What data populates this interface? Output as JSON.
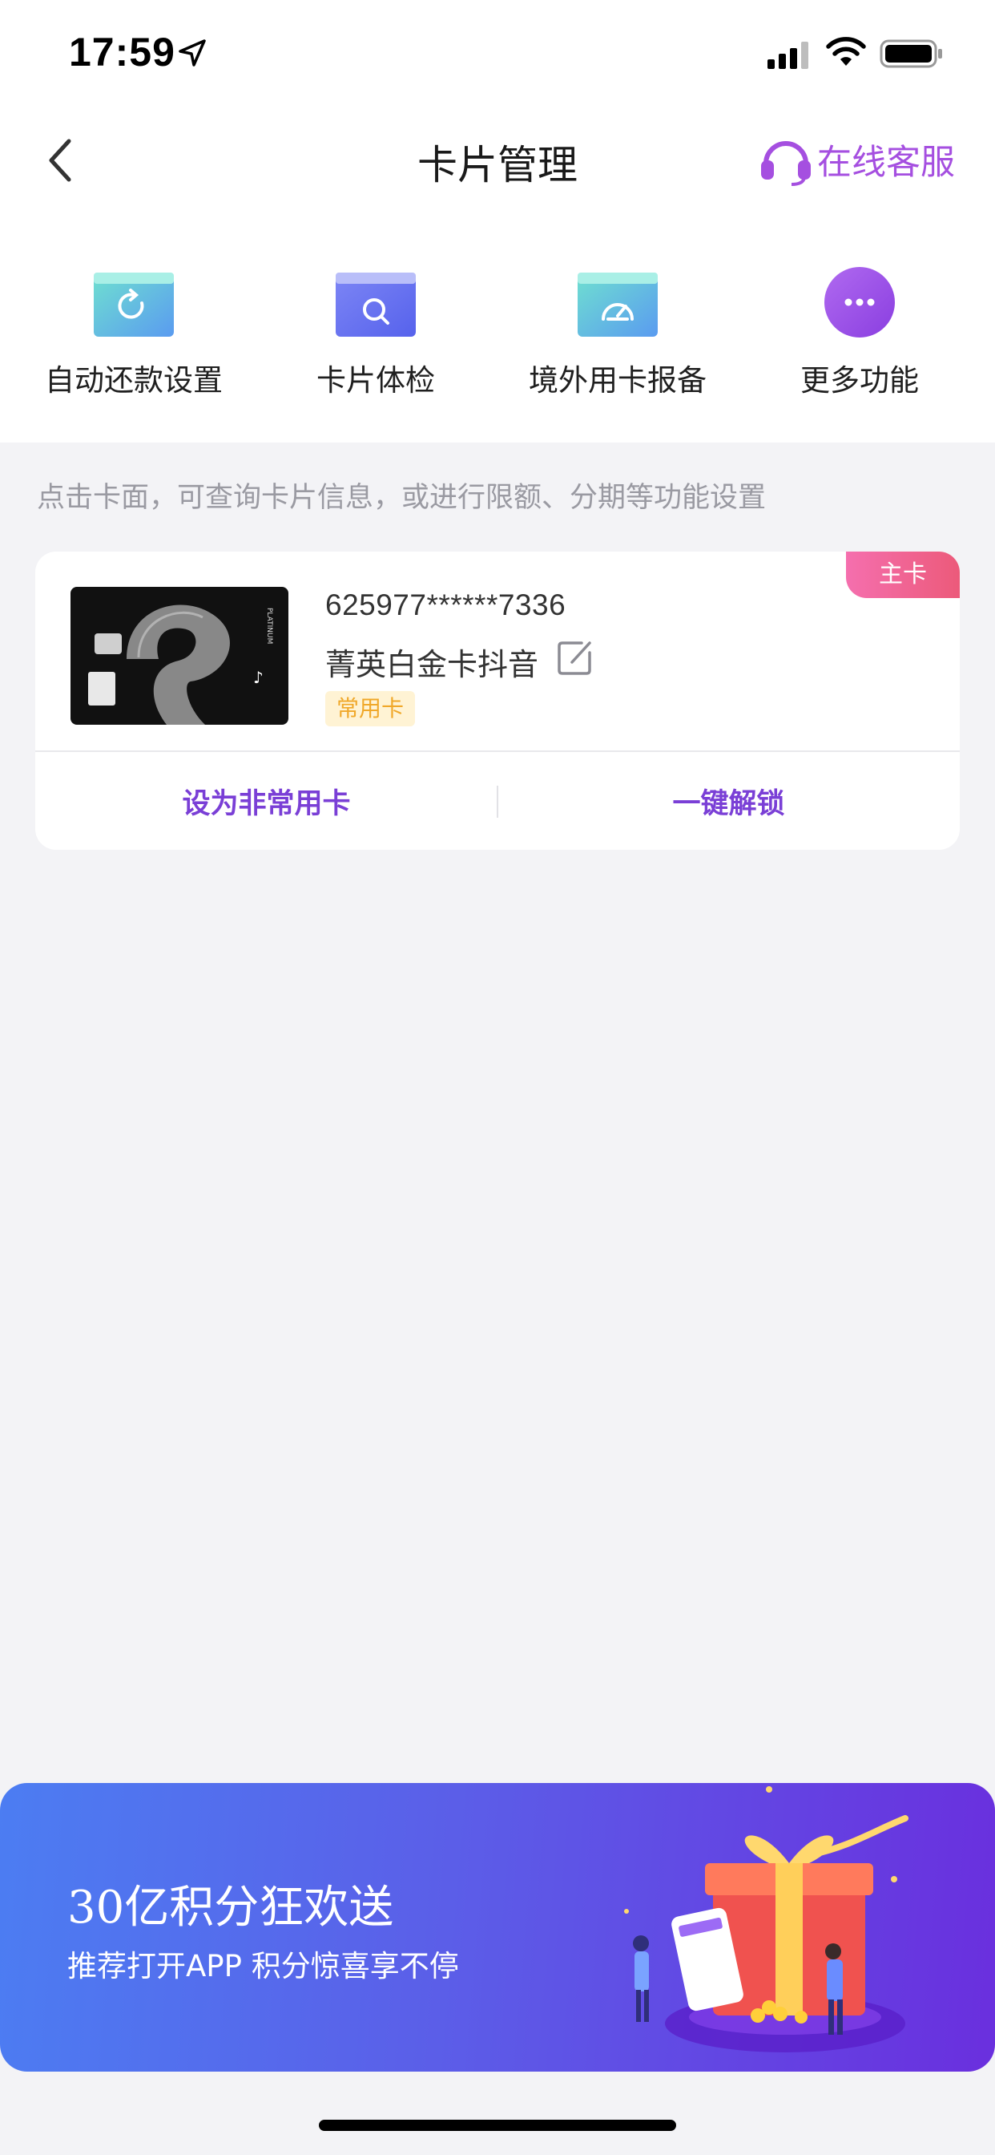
{
  "status_bar": {
    "time": "17:59"
  },
  "nav": {
    "title": "卡片管理",
    "service_label": "在线客服"
  },
  "quick_actions": [
    {
      "label": "自动还款设置",
      "icon": "auto-repay-icon"
    },
    {
      "label": "卡片体检",
      "icon": "card-check-icon"
    },
    {
      "label": "境外用卡报备",
      "icon": "overseas-report-icon"
    },
    {
      "label": "更多功能",
      "icon": "more-icon"
    }
  ],
  "hint": "点击卡面，可查询卡片信息，或进行限额、分期等功能设置",
  "card": {
    "badge": "主卡",
    "number": "625977******7336",
    "name": "菁英白金卡抖音",
    "tag": "常用卡",
    "actions": {
      "set_uncommon": "设为非常用卡",
      "unlock": "一键解锁"
    }
  },
  "banner": {
    "title": "30亿积分狂欢送",
    "subtitle": "推荐打开APP 积分惊喜享不停"
  },
  "colors": {
    "accent": "#7a3fd6",
    "service": "#a54fe0",
    "badge": "#f06a9a",
    "tag_bg": "#fff3d4"
  }
}
